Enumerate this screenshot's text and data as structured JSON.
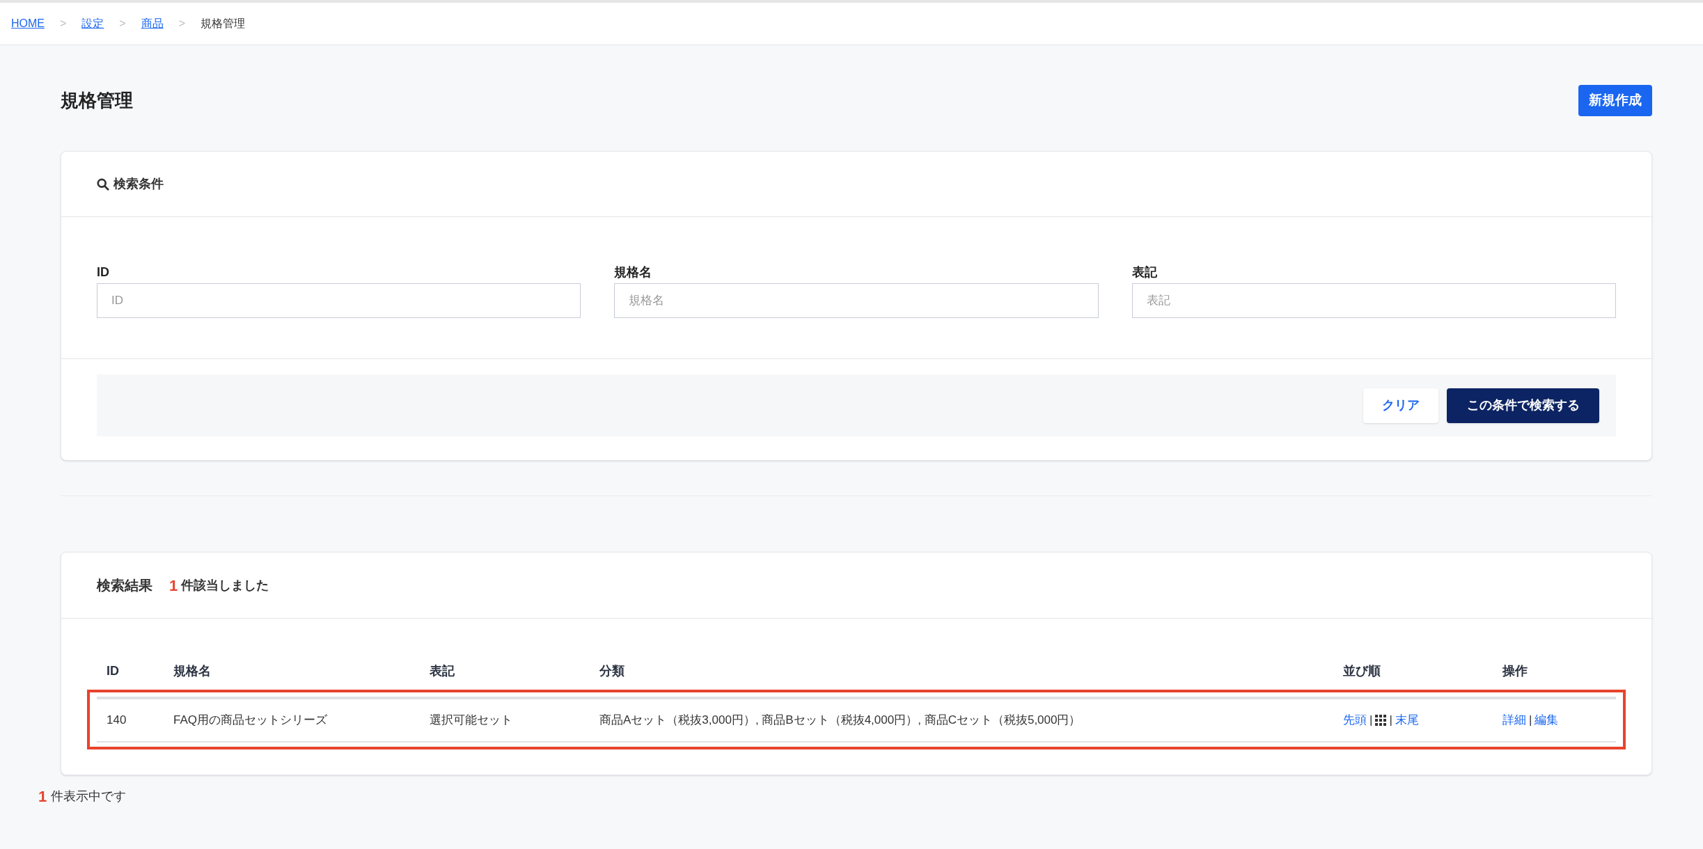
{
  "breadcrumb": [
    {
      "label": "HOME",
      "link": true
    },
    {
      "label": "設定",
      "link": true
    },
    {
      "label": "商品",
      "link": true
    },
    {
      "label": "規格管理",
      "link": false
    }
  ],
  "breadcrumb_separator": ">",
  "page_title": "規格管理",
  "new_button": "新規作成",
  "search": {
    "title": "検索条件",
    "fields": [
      {
        "label": "ID",
        "placeholder": "ID"
      },
      {
        "label": "規格名",
        "placeholder": "規格名"
      },
      {
        "label": "表記",
        "placeholder": "表記"
      }
    ],
    "clear_button": "クリア",
    "submit_button": "この条件で検索する"
  },
  "results": {
    "title": "検索結果",
    "count": "1",
    "count_suffix": "件該当しました",
    "columns": [
      "ID",
      "規格名",
      "表記",
      "分類",
      "並び順",
      "操作"
    ],
    "rows": [
      {
        "highlighted": true,
        "id": "140",
        "name": "FAQ用の商品セットシリーズ",
        "notation": "選択可能セット",
        "category": "商品Aセット（税抜3,000円）, 商品Bセット（税抜4,000円）, 商品Cセット（税抜5,000円）",
        "order_first": "先頭",
        "order_sep_1": "|",
        "order_sep_2": "|",
        "order_last": "末尾",
        "action_detail": "詳細",
        "action_sep": "|",
        "action_edit": "編集"
      }
    ]
  },
  "footer": {
    "count": "1",
    "suffix": "件表示中です"
  }
}
